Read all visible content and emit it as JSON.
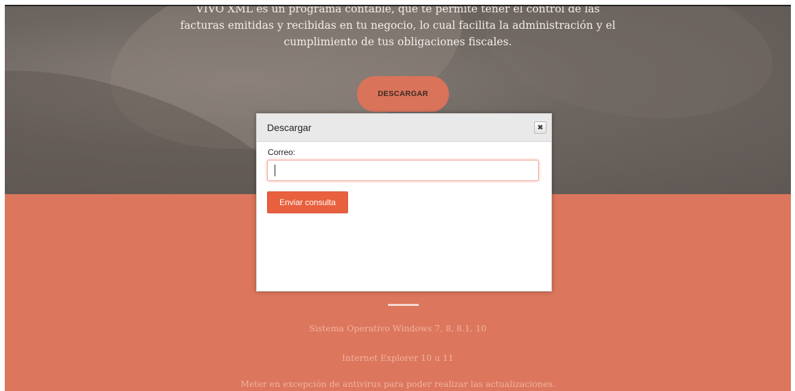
{
  "hero": {
    "line1": "VIVO XML es un programa contable, que te permite tener el control de las",
    "line2": "facturas emitidas y recibidas en tu negocio, lo cual facilita la administración y el",
    "line3": "cumplimiento de tus obligaciones fiscales.",
    "download_label": "DESCARGAR"
  },
  "modal": {
    "title": "Descargar",
    "close_glyph": "✖",
    "email_label": "Correo:",
    "email_value": "",
    "submit_label": "Enviar consulta"
  },
  "requirements": [
    "Sistema Operativo Windows 7, 8, 8.1, 10",
    "Internet Explorer 10 u 11",
    "Meter en excepción de antivirus para poder realizar las actualizaciones."
  ],
  "colors": {
    "accent": "#dc765c",
    "button": "#e8603e",
    "hero_bg": "#6d6560"
  }
}
